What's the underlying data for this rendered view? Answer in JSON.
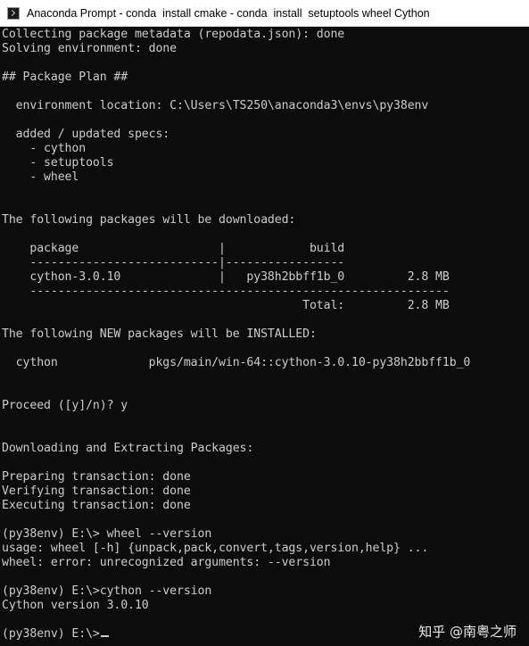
{
  "window": {
    "title": "Anaconda Prompt - conda  install cmake - conda  install  setuptools wheel Cython"
  },
  "console": {
    "lines": [
      "Collecting package metadata (repodata.json): done",
      "Solving environment: done",
      "",
      "## Package Plan ##",
      "",
      "  environment location: C:\\Users\\TS250\\anaconda3\\envs\\py38env",
      "",
      "  added / updated specs:",
      "    - cython",
      "    - setuptools",
      "    - wheel",
      "",
      "",
      "The following packages will be downloaded:",
      "",
      "    package                    |            build",
      "    ---------------------------|-----------------",
      "    cython-3.0.10              |   py38h2bbff1b_0         2.8 MB",
      "    ------------------------------------------------------------",
      "                                           Total:         2.8 MB",
      "",
      "The following NEW packages will be INSTALLED:",
      "",
      "  cython             pkgs/main/win-64::cython-3.0.10-py38h2bbff1b_0",
      "",
      "",
      "Proceed ([y]/n)? y",
      "",
      "",
      "Downloading and Extracting Packages:",
      "",
      "Preparing transaction: done",
      "Verifying transaction: done",
      "Executing transaction: done",
      "",
      "(py38env) E:\\> wheel --version",
      "usage: wheel [-h] {unpack,pack,convert,tags,version,help} ...",
      "wheel: error: unrecognized arguments: --version",
      "",
      "(py38env) E:\\>cython --version",
      "Cython version 3.0.10",
      ""
    ],
    "prompt": "(py38env) E:\\>"
  },
  "watermark": {
    "text": "知乎 @南粤之师"
  }
}
